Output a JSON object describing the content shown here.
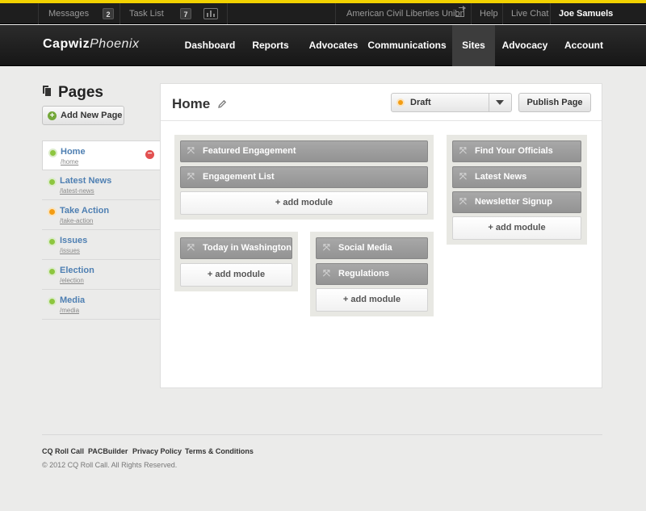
{
  "topbar": {
    "messages_label": "Messages",
    "messages_count": "2",
    "tasklist_label": "Task List",
    "tasklist_count": "7",
    "organization": "American Civil Liberties Union",
    "help": "Help",
    "live_chat": "Live Chat",
    "user": "Joe Samuels"
  },
  "logo": {
    "bold": "Capwiz",
    "italic": "Phoenix"
  },
  "nav": {
    "items": [
      "Dashboard",
      "Reports",
      "Advocates",
      "Communications",
      "Sites",
      "Advocacy",
      "Account"
    ],
    "active": "Sites"
  },
  "sidebar": {
    "title": "Pages",
    "add_button": "Add New Page",
    "pages": [
      {
        "name": "Home",
        "slug": "/home",
        "status": "green"
      },
      {
        "name": "Latest News",
        "slug": "/latest-news",
        "status": "green"
      },
      {
        "name": "Take Action",
        "slug": "/take-action",
        "status": "orange"
      },
      {
        "name": "Issues",
        "slug": "/issues",
        "status": "green"
      },
      {
        "name": "Election",
        "slug": "/election",
        "status": "green"
      },
      {
        "name": "Media",
        "slug": "/media",
        "status": "green"
      }
    ]
  },
  "main": {
    "title": "Home",
    "status_value": "Draft",
    "publish_button": "Publish Page",
    "add_module_label": "+ add module",
    "zones": {
      "top_left": [
        "Featured Engagement",
        "Engagement List"
      ],
      "top_right": [
        "Find Your Officials",
        "Latest News",
        "Newsletter Signup"
      ],
      "bottom_left": [
        "Today in Washington"
      ],
      "bottom_middle": [
        "Social Media",
        "Regulations"
      ]
    }
  },
  "footer": {
    "links": [
      "CQ Roll Call",
      "PACBuilder",
      "Privacy Policy",
      "Terms & Conditions"
    ],
    "copyright": "© 2012 CQ Roll Call. All Rights Reserved."
  },
  "colors": {
    "accent_stripe": "#f2d200",
    "link_blue": "#4e7fb2",
    "status_green": "#8dc63f",
    "status_orange": "#f39c12"
  }
}
